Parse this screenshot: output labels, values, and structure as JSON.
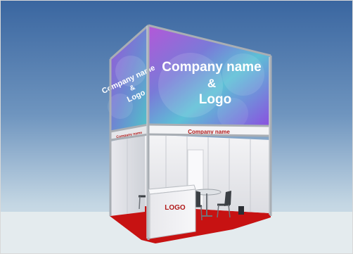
{
  "scene": {
    "upper_banner_front": {
      "line1": "Company name",
      "line2": "&",
      "line3": "Logo"
    },
    "upper_banner_side": {
      "line1": "Company name",
      "line2": "&",
      "line3": "Logo"
    },
    "fascia_front_text": "Company name",
    "fascia_side_text": "Company name",
    "counter_text": "LOGO",
    "colors": {
      "sky_top": "#3d6aa3",
      "sky_bottom": "#c9dbe6",
      "floor": "#e6edf0",
      "carpet": "#c81414",
      "frame": "#b9bec3",
      "wall": "#eef0f2",
      "banner_purple": "#8a4fd6",
      "banner_teal": "#46c6c8",
      "fascia_text": "#b01818"
    }
  }
}
